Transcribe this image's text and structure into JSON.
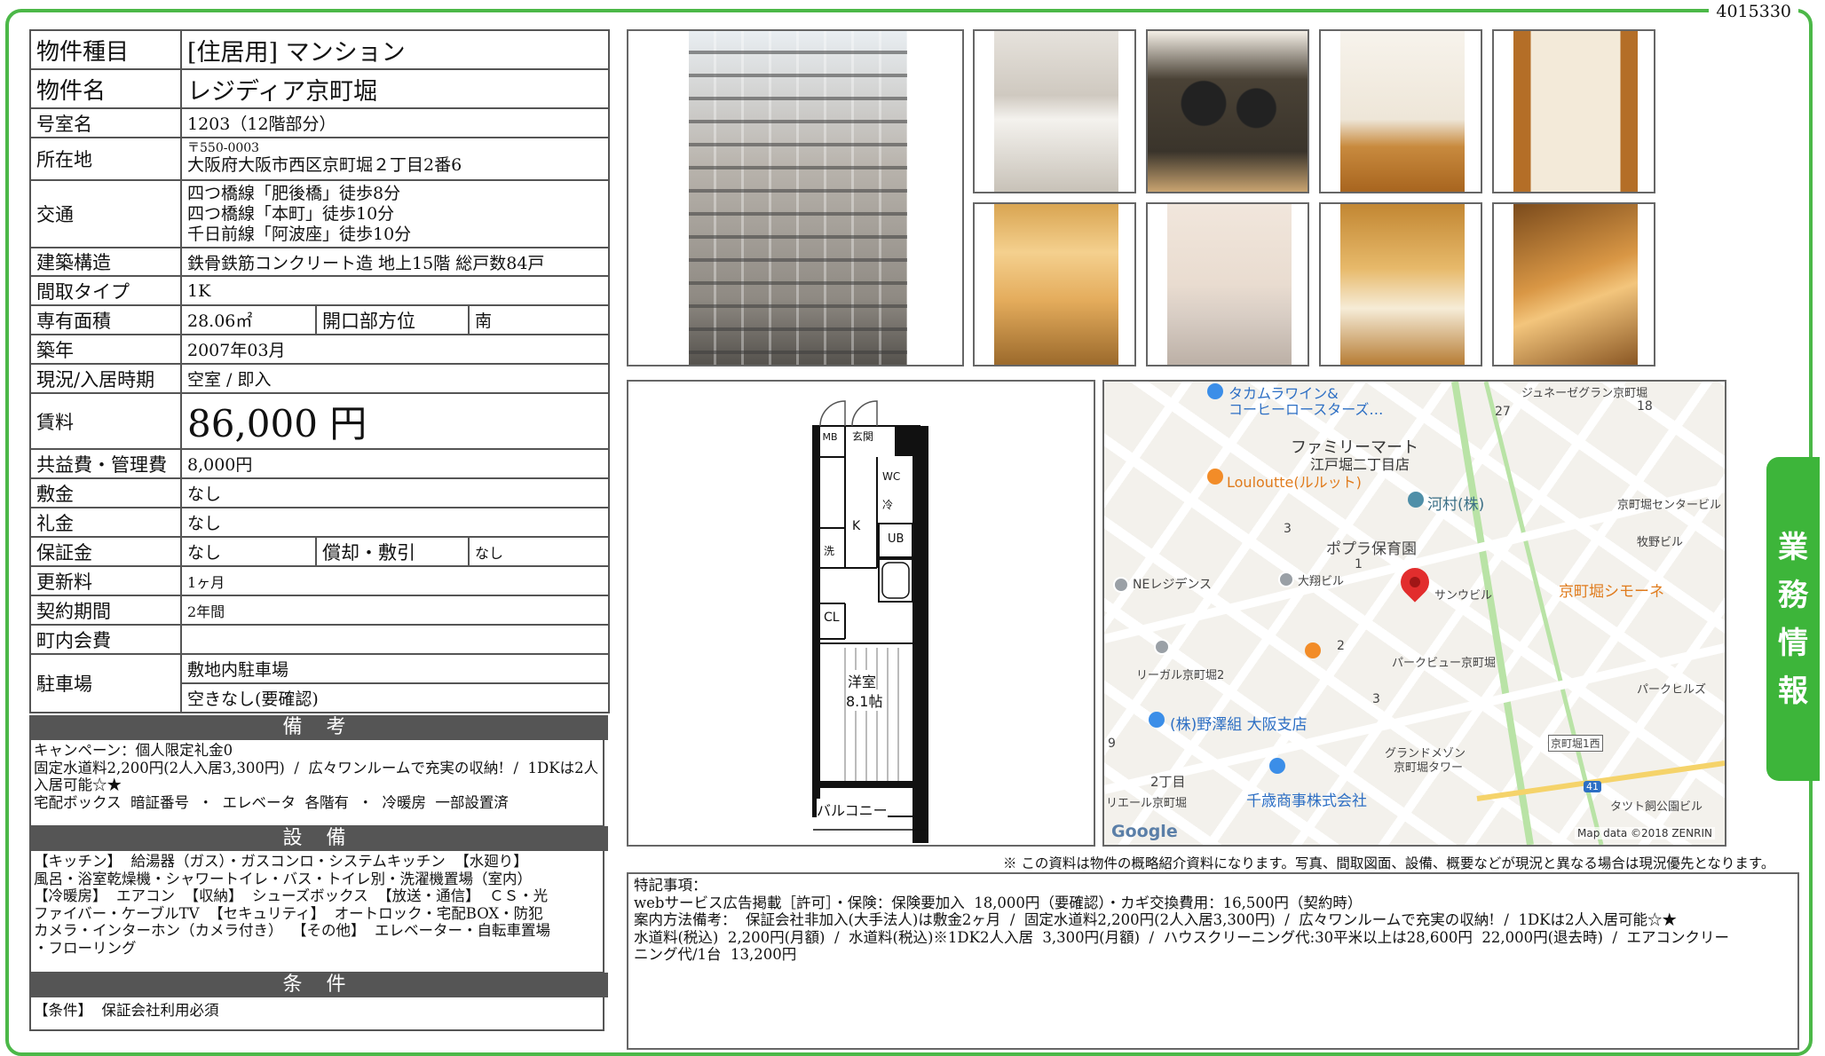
{
  "doc_id": "4015330",
  "side_tab": [
    "業",
    "務",
    "情",
    "報"
  ],
  "property": {
    "type_label": "物件種目",
    "type_value": "[住居用]  マンション",
    "name_label": "物件名",
    "name_value": "レジディア京町堀",
    "room_label": "号室名",
    "room_value": "1203（12階部分）",
    "address_label": "所在地",
    "address_zip": "〒550-0003",
    "address_value": "大阪府大阪市西区京町堀２丁目2番6",
    "access_label": "交通",
    "access_lines": [
      "四つ橋線「肥後橋」徒歩8分",
      "四つ橋線「本町」徒歩10分",
      "千日前線「阿波座」徒歩10分"
    ],
    "structure_label": "建築構造",
    "structure_value": "鉄骨鉄筋コンクリート造  地上15階  総戸数84戸",
    "layout_label": "間取タイプ",
    "layout_value": "1K",
    "area_label": "専有面積",
    "area_value": "28.06㎡",
    "direction_label": "開口部方位",
    "direction_value": "南",
    "built_label": "築年",
    "built_value": "2007年03月",
    "status_label": "現況/入居時期",
    "status_value": "空室  /  即入",
    "rent_label": "賃料",
    "rent_value": "86,000 円",
    "fee_label": "共益費・管理費",
    "fee_value": "8,000円",
    "deposit_label": "敷金",
    "deposit_value": "なし",
    "key_money_label": "礼金",
    "key_money_value": "なし",
    "guarantee_label": "保証金",
    "guarantee_value": "なし",
    "amortization_label": "償却・敷引",
    "amortization_value": "なし",
    "renewal_label": "更新料",
    "renewal_value": "1ヶ月",
    "contract_label": "契約期間",
    "contract_value": "2年間",
    "town_fee_label": "町内会費",
    "town_fee_value": "",
    "parking_label": "駐車場",
    "parking_value1": "敷地内駐車場",
    "parking_value2": "空きなし(要確認)"
  },
  "remarks": {
    "title": "備 考",
    "lines": [
      "キャンペーン：個人限定礼金0",
      "固定水道料2,200円(2人入居3,300円)  /  広々ワンルームで充実の収納!  /  1DKは2人入居可能☆★",
      "宅配ボックス  暗証番号  ・  エレベータ  各階有  ・  冷暖房  一部設置済"
    ]
  },
  "equipment": {
    "title": "設 備",
    "lines": [
      "【キッチン】  給湯器（ガス）・ガスコンロ・システムキッチン  【水廻り】",
      "風呂・浴室乾燥機・シャワートイレ・バス・トイレ別・洗濯機置場（室内）",
      "【冷暖房】  エアコン  【収納】  シューズボックス  【放送・通信】  ＣＳ・光",
      "ファイバー・ケーブルTV  【セキュリティ】  オートロック・宅配BOX・防犯",
      "カメラ・インターホン（カメラ付き）  【その他】  エレベーター・自転車置場",
      "・フローリング"
    ]
  },
  "conditions": {
    "title": "条 件",
    "lines": [
      "【条件】  保証会社利用必須"
    ]
  },
  "floorplan": {
    "labels": [
      "MB",
      "玄関",
      "WC",
      "冷",
      "K",
      "UB",
      "洗",
      "CL",
      "洋室",
      "8.1帖",
      "バルコニー"
    ]
  },
  "map": {
    "labels": [
      "タカムラワイン&",
      "コーヒーロースターズ…",
      "ジュネーゼグラン京町堀",
      "27",
      "18",
      "ファミリーマート",
      "江戸堀二丁目店",
      "Louloutte(ルルット)",
      "河村(株)",
      "京町堀センタービル",
      "3",
      "ポプラ保育園",
      "牧野ビル",
      "NEレジデンス",
      "大翔ビル",
      "1",
      "サンウビル",
      "京町堀シモーネ",
      "2",
      "パークビュー京町堀",
      "リーガル京町堀2",
      "3",
      "パークヒルズ",
      "(株)野澤組 大阪支店",
      "京町堀1西",
      "9",
      "グランドメゾン",
      "京町堀タワー",
      "2丁目",
      "千歳商事株式会社",
      "41",
      "リエール京町堀",
      "タツト飼公園ビル",
      "Google",
      "Map data ©2018 ZENRIN"
    ]
  },
  "notice": "※  この資料は物件の概略紹介資料になります。写真、間取図面、設備、概要などが現況と異なる場合は現況優先となります。",
  "memo": {
    "lines": [
      "特記事項：",
      "webサービス広告掲載［許可］・保険：保険要加入  18,000円（要確認）・カギ交換費用：16,500円（契約時）",
      "案内方法備考：  保証会社非加入(大手法人)は敷金2ヶ月  /  固定水道料2,200円(2人入居3,300円)  /  広々ワンルームで充実の収納!  /  1DKは2人入居可能☆★",
      "水道料(税込)  2,200円(月額)  /  水道料(税込)※1DK2人入居  3,300円(月額)  /  ハウスクリーニング代:30平米以上は28,600円  22,000円(退去時)  /  エアコンクリー",
      "ニング代/1台  13,200円"
    ]
  },
  "colors": {
    "frame": "#4cb848",
    "side_tab": "#3db53a",
    "section_head": "#555555",
    "map_pin": "#e22d2d"
  }
}
